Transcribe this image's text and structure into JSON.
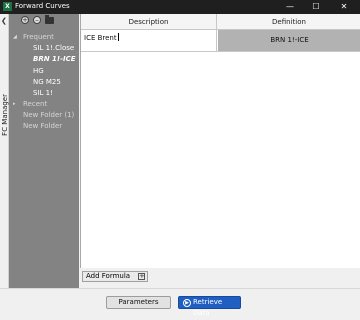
{
  "window": {
    "title": "Forward Curves",
    "app_icon": "X"
  },
  "sidebar": {
    "label": "FC Manager",
    "collapse_icon": "chevron-left-icon"
  },
  "tree": {
    "toolbar": [
      "add-circle-icon",
      "remove-circle-icon",
      "open-folder-icon"
    ],
    "frequent_label": "Frequent",
    "items": [
      "SIL 1!.Close",
      "BRN 1!-ICE",
      "HG",
      "NG M25",
      "SIL 1!"
    ],
    "recent_label": "Recent",
    "folders": [
      "New Folder (1)",
      "New Folder"
    ]
  },
  "grid": {
    "columns": [
      "Description",
      "Definition"
    ],
    "rows": [
      {
        "description": "ICE Brent",
        "definition": "BRN 1!-ICE"
      }
    ]
  },
  "add_formula": {
    "label": "Add Formula"
  },
  "buttons": {
    "parameters": "Parameters",
    "retrieve": "Retrieve Data"
  },
  "colors": {
    "titlebar": "#1f1f1f",
    "tree_panel": "#838383",
    "definition_cell": "#b2b2b2",
    "accent": "#1f5fc2"
  }
}
